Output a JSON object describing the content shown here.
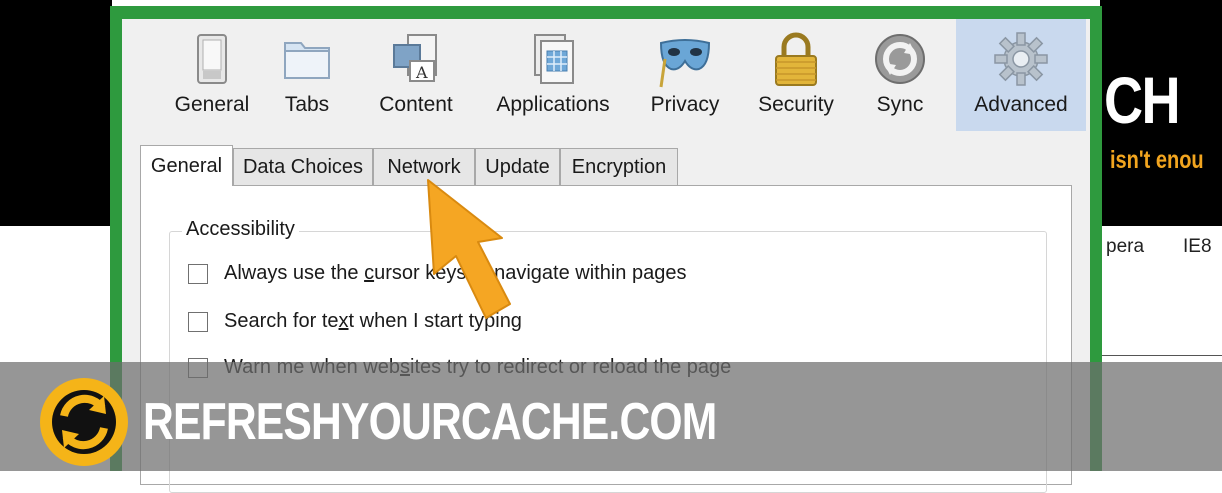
{
  "background_site": {
    "logo_fragment": "CH",
    "tagline_fragment": "isn't enou",
    "nav_items": [
      "pera",
      "IE8"
    ]
  },
  "toolbar": {
    "panes": [
      {
        "label": "General",
        "icon": "switch-icon"
      },
      {
        "label": "Tabs",
        "icon": "folder-tabs-icon"
      },
      {
        "label": "Content",
        "icon": "content-page-icon"
      },
      {
        "label": "Applications",
        "icon": "applications-icon"
      },
      {
        "label": "Privacy",
        "icon": "mask-icon"
      },
      {
        "label": "Security",
        "icon": "padlock-icon"
      },
      {
        "label": "Sync",
        "icon": "sync-icon"
      },
      {
        "label": "Advanced",
        "icon": "gear-icon"
      }
    ],
    "selected": "Advanced"
  },
  "subtabs": {
    "items": [
      "General",
      "Data Choices",
      "Network",
      "Update",
      "Encryption"
    ],
    "active": "General"
  },
  "accessibility": {
    "legend": "Accessibility",
    "options": [
      {
        "pre": "Always use the ",
        "mnemonic": "c",
        "post": "ursor keys to navigate within pages",
        "checked": false
      },
      {
        "pre": "Search for te",
        "mnemonic": "x",
        "post": "t when I start typing",
        "checked": false
      },
      {
        "pre": "Warn me when web",
        "mnemonic": "s",
        "post": "ites try to redirect or reload the page",
        "checked": false
      }
    ]
  },
  "watermark": {
    "text": "REFRESHYOURCACHE.COM"
  },
  "colors": {
    "frame_green": "#2e9a3e",
    "selected_pane": "#c9d9ee",
    "arrow_orange": "#f5a623",
    "tagline_orange": "#f2a51f"
  }
}
